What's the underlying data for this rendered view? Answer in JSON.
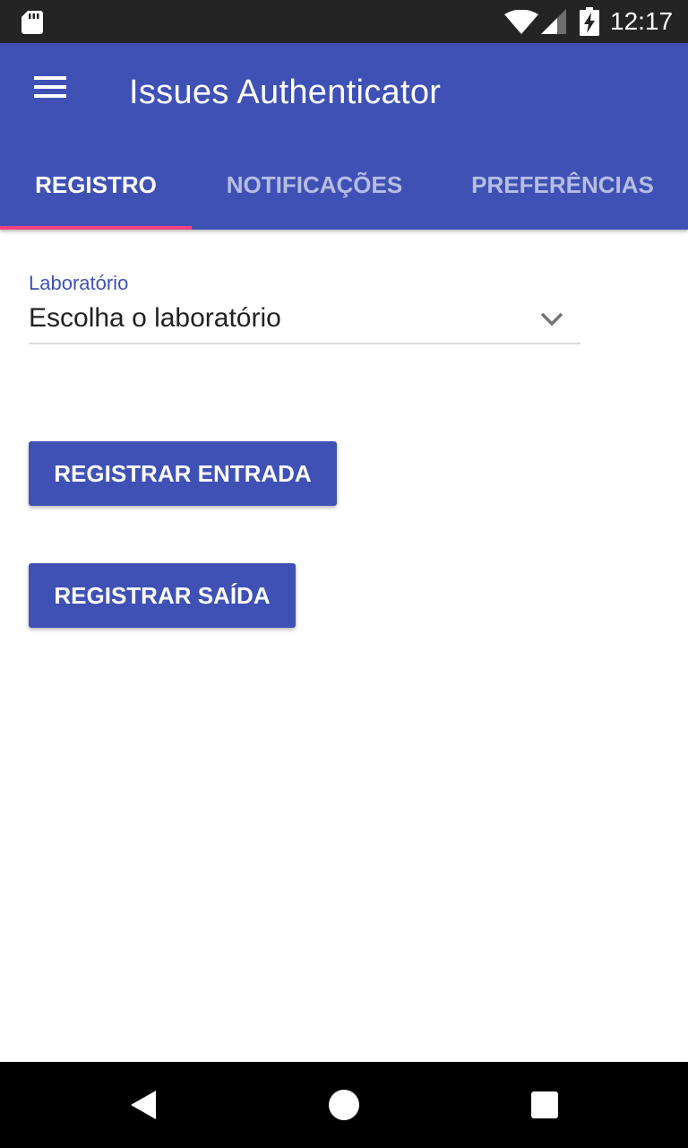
{
  "status_bar": {
    "time": "12:17",
    "icons": [
      "sd-card-icon",
      "wifi-icon",
      "cell-signal-icon",
      "battery-charging-icon"
    ]
  },
  "app_bar": {
    "title": "Issues Authenticator",
    "menu_icon": "hamburger-menu-icon",
    "color": "#3f51b5"
  },
  "tabs": [
    {
      "label": "REGISTRO",
      "active": true
    },
    {
      "label": "NOTIFICAÇÕES",
      "active": false
    },
    {
      "label": "PREFERÊNCIAS",
      "active": false
    }
  ],
  "tab_indicator_color": "#ff4081",
  "form": {
    "laboratorio_label": "Laboratório",
    "laboratorio_value": "Escolha o laboratório",
    "dropdown_icon": "chevron-down-icon"
  },
  "actions": {
    "entrada_label": "REGISTRAR ENTRADA",
    "saida_label": "REGISTRAR SAÍDA"
  },
  "nav_bar": {
    "icons": [
      "back-icon",
      "home-icon",
      "recents-icon"
    ]
  }
}
